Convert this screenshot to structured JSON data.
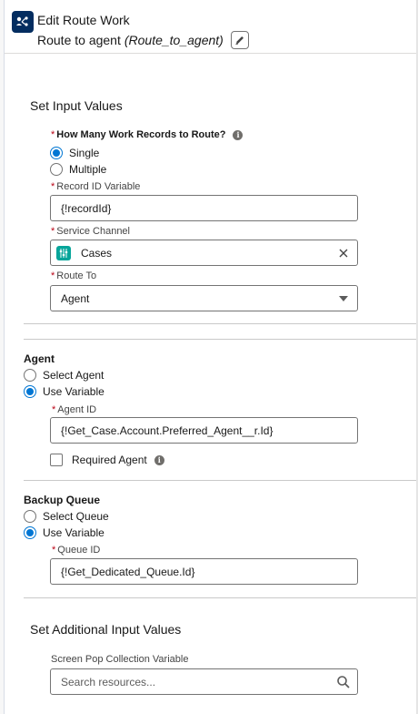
{
  "header": {
    "title": "Edit Route Work",
    "element_label": "Route to agent",
    "element_api_name": "(Route_to_agent)",
    "icon": "route-work-icon",
    "edit_icon": "pencil-icon"
  },
  "input_values": {
    "section_title": "Set Input Values",
    "records_question": "How Many Work Records to Route?",
    "options": {
      "single": "Single",
      "multiple": "Multiple"
    },
    "selected_option": "Single",
    "record_id_label": "Record ID Variable",
    "record_id_value": "{!recordId}",
    "service_channel_label": "Service Channel",
    "service_channel_value": "Cases",
    "route_to_label": "Route To",
    "route_to_value": "Agent"
  },
  "agent": {
    "group_title": "Agent",
    "options": {
      "select": "Select Agent",
      "variable": "Use Variable"
    },
    "selected_option": "Use Variable",
    "agent_id_label": "Agent ID",
    "agent_id_value": "{!Get_Case.Account.Preferred_Agent__r.Id}",
    "required_agent_label": "Required Agent",
    "required_agent_checked": false
  },
  "backup_queue": {
    "group_title": "Backup Queue",
    "options": {
      "select": "Select Queue",
      "variable": "Use Variable"
    },
    "selected_option": "Use Variable",
    "queue_id_label": "Queue ID",
    "queue_id_value": "{!Get_Dedicated_Queue.Id}"
  },
  "additional": {
    "section_title": "Set Additional Input Values",
    "screen_pop_label": "Screen Pop Collection Variable",
    "search_placeholder": "Search resources..."
  },
  "colors": {
    "brand_blue": "#0176d3",
    "header_icon_bg": "#032d60",
    "channel_icon_bg": "#06a59a",
    "required_star": "#ba0517"
  }
}
